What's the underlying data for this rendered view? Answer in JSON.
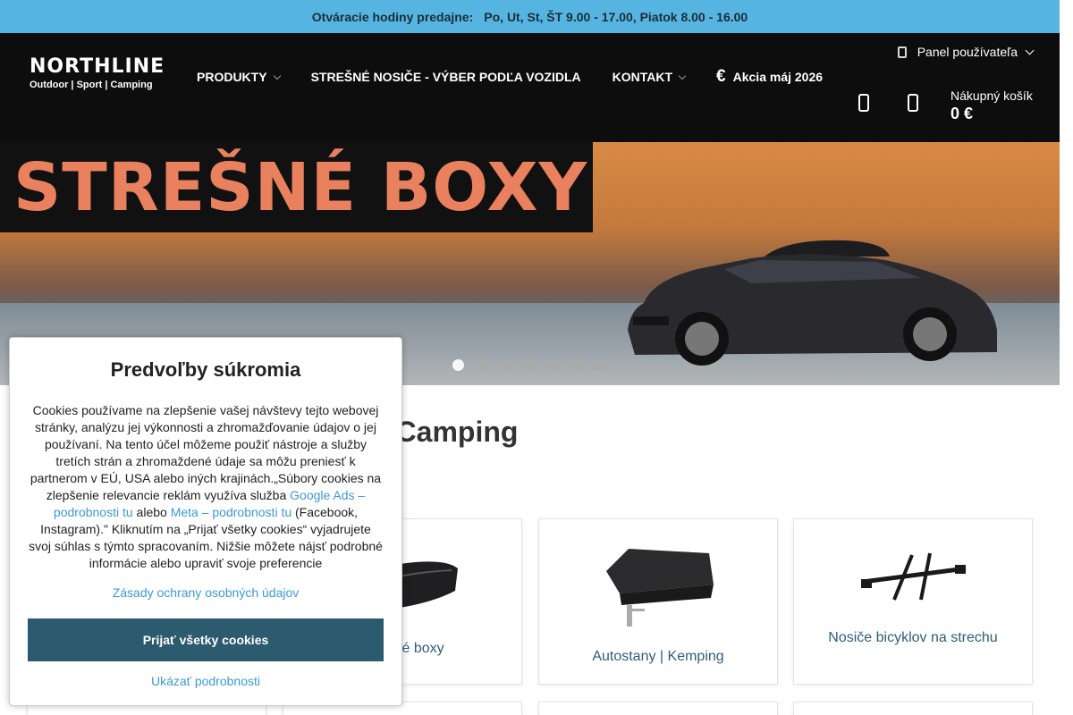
{
  "topbar": {
    "label": "Otváracie hodiny predajne:",
    "hours": "Po, Ut, St, ŠT  9.00 - 17.00, Piatok 8.00 - 16.00"
  },
  "header": {
    "user_panel": "Panel používateľa",
    "logo_brand": "NORTHLINE",
    "logo_tag": "Outdoor | Sport | Camping",
    "nav": {
      "products": "PRODUKTY",
      "roof_racks": "STREŠNÉ NOSIČE - VÝBER PODĽA VOZIDLA",
      "contact": "KONTAKT",
      "promo_symbol": "€",
      "promo": "Akcia máj 2026"
    },
    "cart": {
      "label": "Nákupný košík",
      "amount": "0 €"
    }
  },
  "hero": {
    "title": "STREŠNÉ BOXY",
    "slides": 7,
    "active_slide": 1
  },
  "main": {
    "heading": "Northline Outdoor | Sport | Camping",
    "categories": [
      {
        "label": ""
      },
      {
        "label": "Strešné boxy"
      },
      {
        "label": "Autostany | Kemping"
      },
      {
        "label": "Nosiče bicyklov na strechu"
      }
    ]
  },
  "cookie_modal": {
    "title": "Predvoľby súkromia",
    "text_1": "Cookies používame na zlepšenie vašej návštevy tejto webovej stránky, analýzu jej výkonnosti a zhromažďovanie údajov o jej používaní. Na tento účel môžeme použiť nástroje a služby tretích strán a zhromaždené údaje sa môžu preniesť k partnerom v EÚ, USA alebo iných krajinách.„Súbory cookies na zlepšenie relevancie reklám využíva služba ",
    "link_google": "Google Ads – podrobnosti tu",
    "text_2": " alebo ",
    "link_meta": "Meta – podrobnosti tu",
    "text_3": " (Facebook, Instagram).\" Kliknutím na „Prijať všetky cookies“ vyjadrujete svoj súhlas s týmto spracovaním. Nižšie môžete nájsť podrobné informácie alebo upraviť svoje preferencie",
    "privacy_link": "Zásady ochrany osobných údajov",
    "accept_button": "Prijať všetky cookies",
    "show_details": "Ukázať podrobnosti"
  },
  "colors": {
    "topbar_bg": "#55b5e0",
    "header_bg": "#0d0d0d",
    "accent_button": "#2c5a6f",
    "link": "#3c9ad4",
    "hero_title": "#e9805e"
  }
}
